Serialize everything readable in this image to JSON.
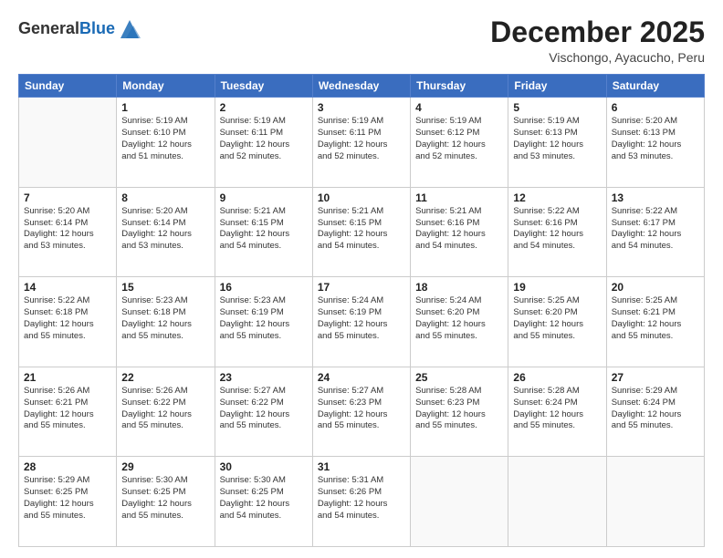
{
  "brand": {
    "general": "General",
    "blue": "Blue"
  },
  "title": "December 2025",
  "subtitle": "Vischongo, Ayacucho, Peru",
  "days": [
    "Sunday",
    "Monday",
    "Tuesday",
    "Wednesday",
    "Thursday",
    "Friday",
    "Saturday"
  ],
  "weeks": [
    [
      {
        "day": "",
        "info": ""
      },
      {
        "day": "1",
        "info": "Sunrise: 5:19 AM\nSunset: 6:10 PM\nDaylight: 12 hours\nand 51 minutes."
      },
      {
        "day": "2",
        "info": "Sunrise: 5:19 AM\nSunset: 6:11 PM\nDaylight: 12 hours\nand 52 minutes."
      },
      {
        "day": "3",
        "info": "Sunrise: 5:19 AM\nSunset: 6:11 PM\nDaylight: 12 hours\nand 52 minutes."
      },
      {
        "day": "4",
        "info": "Sunrise: 5:19 AM\nSunset: 6:12 PM\nDaylight: 12 hours\nand 52 minutes."
      },
      {
        "day": "5",
        "info": "Sunrise: 5:19 AM\nSunset: 6:13 PM\nDaylight: 12 hours\nand 53 minutes."
      },
      {
        "day": "6",
        "info": "Sunrise: 5:20 AM\nSunset: 6:13 PM\nDaylight: 12 hours\nand 53 minutes."
      }
    ],
    [
      {
        "day": "7",
        "info": "Sunrise: 5:20 AM\nSunset: 6:14 PM\nDaylight: 12 hours\nand 53 minutes."
      },
      {
        "day": "8",
        "info": "Sunrise: 5:20 AM\nSunset: 6:14 PM\nDaylight: 12 hours\nand 53 minutes."
      },
      {
        "day": "9",
        "info": "Sunrise: 5:21 AM\nSunset: 6:15 PM\nDaylight: 12 hours\nand 54 minutes."
      },
      {
        "day": "10",
        "info": "Sunrise: 5:21 AM\nSunset: 6:15 PM\nDaylight: 12 hours\nand 54 minutes."
      },
      {
        "day": "11",
        "info": "Sunrise: 5:21 AM\nSunset: 6:16 PM\nDaylight: 12 hours\nand 54 minutes."
      },
      {
        "day": "12",
        "info": "Sunrise: 5:22 AM\nSunset: 6:16 PM\nDaylight: 12 hours\nand 54 minutes."
      },
      {
        "day": "13",
        "info": "Sunrise: 5:22 AM\nSunset: 6:17 PM\nDaylight: 12 hours\nand 54 minutes."
      }
    ],
    [
      {
        "day": "14",
        "info": "Sunrise: 5:22 AM\nSunset: 6:18 PM\nDaylight: 12 hours\nand 55 minutes."
      },
      {
        "day": "15",
        "info": "Sunrise: 5:23 AM\nSunset: 6:18 PM\nDaylight: 12 hours\nand 55 minutes."
      },
      {
        "day": "16",
        "info": "Sunrise: 5:23 AM\nSunset: 6:19 PM\nDaylight: 12 hours\nand 55 minutes."
      },
      {
        "day": "17",
        "info": "Sunrise: 5:24 AM\nSunset: 6:19 PM\nDaylight: 12 hours\nand 55 minutes."
      },
      {
        "day": "18",
        "info": "Sunrise: 5:24 AM\nSunset: 6:20 PM\nDaylight: 12 hours\nand 55 minutes."
      },
      {
        "day": "19",
        "info": "Sunrise: 5:25 AM\nSunset: 6:20 PM\nDaylight: 12 hours\nand 55 minutes."
      },
      {
        "day": "20",
        "info": "Sunrise: 5:25 AM\nSunset: 6:21 PM\nDaylight: 12 hours\nand 55 minutes."
      }
    ],
    [
      {
        "day": "21",
        "info": "Sunrise: 5:26 AM\nSunset: 6:21 PM\nDaylight: 12 hours\nand 55 minutes."
      },
      {
        "day": "22",
        "info": "Sunrise: 5:26 AM\nSunset: 6:22 PM\nDaylight: 12 hours\nand 55 minutes."
      },
      {
        "day": "23",
        "info": "Sunrise: 5:27 AM\nSunset: 6:22 PM\nDaylight: 12 hours\nand 55 minutes."
      },
      {
        "day": "24",
        "info": "Sunrise: 5:27 AM\nSunset: 6:23 PM\nDaylight: 12 hours\nand 55 minutes."
      },
      {
        "day": "25",
        "info": "Sunrise: 5:28 AM\nSunset: 6:23 PM\nDaylight: 12 hours\nand 55 minutes."
      },
      {
        "day": "26",
        "info": "Sunrise: 5:28 AM\nSunset: 6:24 PM\nDaylight: 12 hours\nand 55 minutes."
      },
      {
        "day": "27",
        "info": "Sunrise: 5:29 AM\nSunset: 6:24 PM\nDaylight: 12 hours\nand 55 minutes."
      }
    ],
    [
      {
        "day": "28",
        "info": "Sunrise: 5:29 AM\nSunset: 6:25 PM\nDaylight: 12 hours\nand 55 minutes."
      },
      {
        "day": "29",
        "info": "Sunrise: 5:30 AM\nSunset: 6:25 PM\nDaylight: 12 hours\nand 55 minutes."
      },
      {
        "day": "30",
        "info": "Sunrise: 5:30 AM\nSunset: 6:25 PM\nDaylight: 12 hours\nand 54 minutes."
      },
      {
        "day": "31",
        "info": "Sunrise: 5:31 AM\nSunset: 6:26 PM\nDaylight: 12 hours\nand 54 minutes."
      },
      {
        "day": "",
        "info": ""
      },
      {
        "day": "",
        "info": ""
      },
      {
        "day": "",
        "info": ""
      }
    ]
  ]
}
